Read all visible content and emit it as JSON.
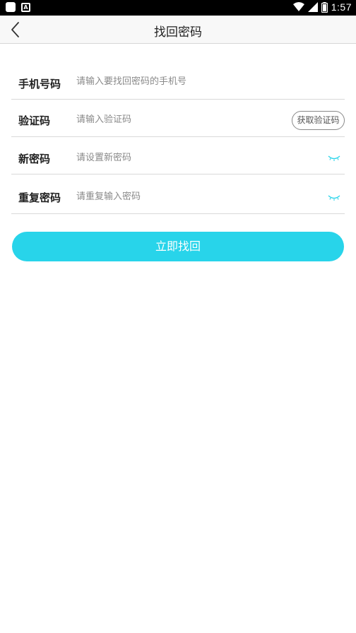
{
  "status_bar": {
    "time": "1:57",
    "icons": [
      "app-icon",
      "a-icon",
      "wifi-icon",
      "signal-icon",
      "battery-icon"
    ]
  },
  "header": {
    "back_icon": "chevron-left-icon",
    "title": "找回密码"
  },
  "form": {
    "phone": {
      "label": "手机号码",
      "placeholder": "请输入要找回密码的手机号"
    },
    "code": {
      "label": "验证码",
      "placeholder": "请输入验证码",
      "button": "获取验证码"
    },
    "new_password": {
      "label": "新密码",
      "placeholder": "请设置新密码",
      "toggle_icon": "eye-closed-icon"
    },
    "repeat_password": {
      "label": "重复密码",
      "placeholder": "请重复输入密码",
      "toggle_icon": "eye-closed-icon"
    }
  },
  "submit_label": "立即找回",
  "colors": {
    "accent": "#28d4ea",
    "divider": "#d9d9d9",
    "header_bg": "#f8f8f8"
  }
}
